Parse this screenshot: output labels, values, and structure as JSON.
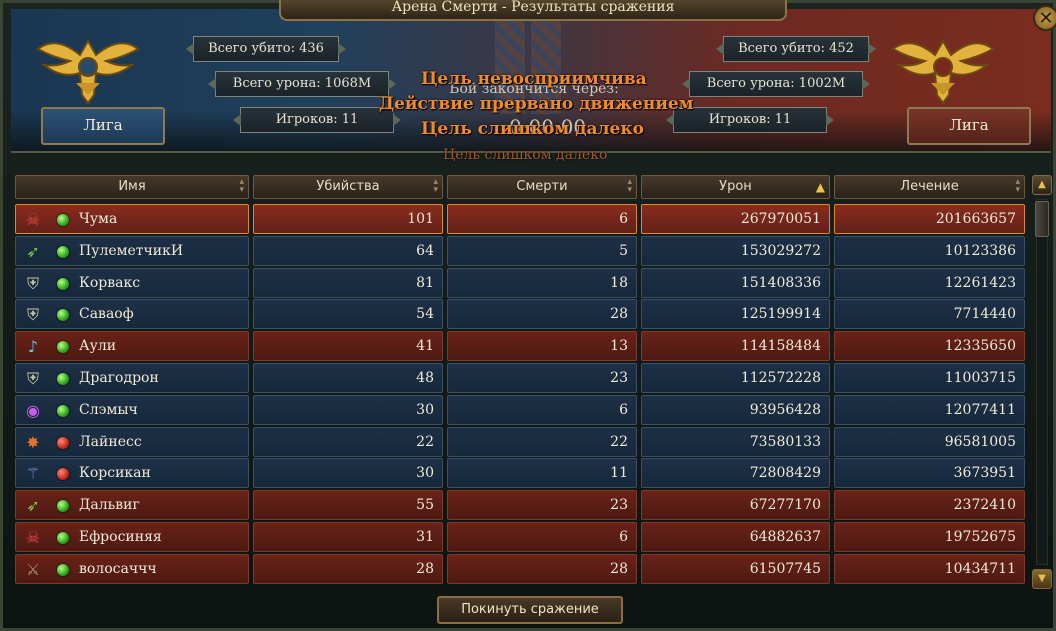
{
  "window": {
    "title": "Арена Смерти - Результаты сражения",
    "close_label": "✕"
  },
  "team_left": {
    "name": "Лига",
    "kills": "Всего убито: 436",
    "damage": "Всего урона: 1068M",
    "players": "Игроков: 11",
    "color": "#1e3a56"
  },
  "team_right": {
    "name": "Лига",
    "kills": "Всего убито: 452",
    "damage": "Всего урона: 1002M",
    "players": "Игроков: 11",
    "color": "#55231a"
  },
  "battle": {
    "end_label": "Бой закончится через:",
    "timer": "0:00:00"
  },
  "messages": [
    "Цель невосприимчива",
    "Действие прервано движением",
    "Цель слишком далеко"
  ],
  "message_faded": "Цель слишком далеко",
  "table": {
    "columns": [
      {
        "label": "Имя",
        "sort": "both"
      },
      {
        "label": "Убийства",
        "sort": "both"
      },
      {
        "label": "Смерти",
        "sort": "both"
      },
      {
        "label": "Урон",
        "sort": "up"
      },
      {
        "label": "Лечение",
        "sort": "both"
      }
    ],
    "rows": [
      {
        "icon": "skull-icon",
        "glyph": "☠",
        "icon_color": "#e04a4a",
        "status": "green",
        "team": "red",
        "highlighted": true,
        "name": "Чума",
        "kills": "101",
        "deaths": "6",
        "damage": "267970051",
        "healing": "201663657"
      },
      {
        "icon": "arrow-icon",
        "glyph": "➶",
        "icon_color": "#7ed04a",
        "status": "green",
        "team": "blue",
        "highlighted": false,
        "name": "ПулеметчикИ",
        "kills": "64",
        "deaths": "5",
        "damage": "153029272",
        "healing": "10123386"
      },
      {
        "icon": "shield-icon",
        "glyph": "⛨",
        "icon_color": "#c8c4a8",
        "status": "green",
        "team": "blue",
        "highlighted": false,
        "name": "Корвакс",
        "kills": "81",
        "deaths": "18",
        "damage": "151408336",
        "healing": "12261423"
      },
      {
        "icon": "shield-icon",
        "glyph": "⛨",
        "icon_color": "#c8c4a8",
        "status": "green",
        "team": "blue",
        "highlighted": false,
        "name": "Саваоф",
        "kills": "54",
        "deaths": "28",
        "damage": "125199914",
        "healing": "7714440"
      },
      {
        "icon": "lute-icon",
        "glyph": "♪",
        "icon_color": "#5ac8e8",
        "status": "green",
        "team": "red",
        "highlighted": false,
        "name": "Аули",
        "kills": "41",
        "deaths": "13",
        "damage": "114158484",
        "healing": "12335650"
      },
      {
        "icon": "shield-icon",
        "glyph": "⛨",
        "icon_color": "#c8c4a8",
        "status": "green",
        "team": "blue",
        "highlighted": false,
        "name": "Драгодрон",
        "kills": "48",
        "deaths": "23",
        "damage": "112572228",
        "healing": "11003715"
      },
      {
        "icon": "eye-icon",
        "glyph": "◉",
        "icon_color": "#c060e8",
        "status": "green",
        "team": "blue",
        "highlighted": false,
        "name": "Слэмыч",
        "kills": "30",
        "deaths": "6",
        "damage": "93956428",
        "healing": "12077411"
      },
      {
        "icon": "paw-icon",
        "glyph": "✸",
        "icon_color": "#e8702a",
        "status": "red",
        "team": "blue",
        "highlighted": false,
        "name": "Лайнесс",
        "kills": "22",
        "deaths": "22",
        "damage": "73580133",
        "healing": "96581005"
      },
      {
        "icon": "staff-icon",
        "glyph": "⚚",
        "icon_color": "#7a9ae8",
        "status": "red",
        "team": "blue",
        "highlighted": false,
        "name": "Корсикан",
        "kills": "30",
        "deaths": "11",
        "damage": "72808429",
        "healing": "3673951"
      },
      {
        "icon": "arrow-icon",
        "glyph": "➶",
        "icon_color": "#7ed04a",
        "status": "green",
        "team": "red",
        "highlighted": false,
        "name": "Дальвиг",
        "kills": "55",
        "deaths": "23",
        "damage": "67277170",
        "healing": "2372410"
      },
      {
        "icon": "skull-icon",
        "glyph": "☠",
        "icon_color": "#e04a4a",
        "status": "green",
        "team": "red",
        "highlighted": false,
        "name": "Ефросиняя",
        "kills": "31",
        "deaths": "6",
        "damage": "64882637",
        "healing": "19752675"
      },
      {
        "icon": "sword-icon",
        "glyph": "⚔",
        "icon_color": "#a89070",
        "status": "green",
        "team": "red",
        "highlighted": false,
        "name": "волосаччч",
        "kills": "28",
        "deaths": "28",
        "damage": "61507745",
        "healing": "10434711"
      }
    ]
  },
  "footer": {
    "leave_label": "Покинуть сражение"
  },
  "scroll": {
    "up_label": "▲",
    "down_label": "▼"
  }
}
